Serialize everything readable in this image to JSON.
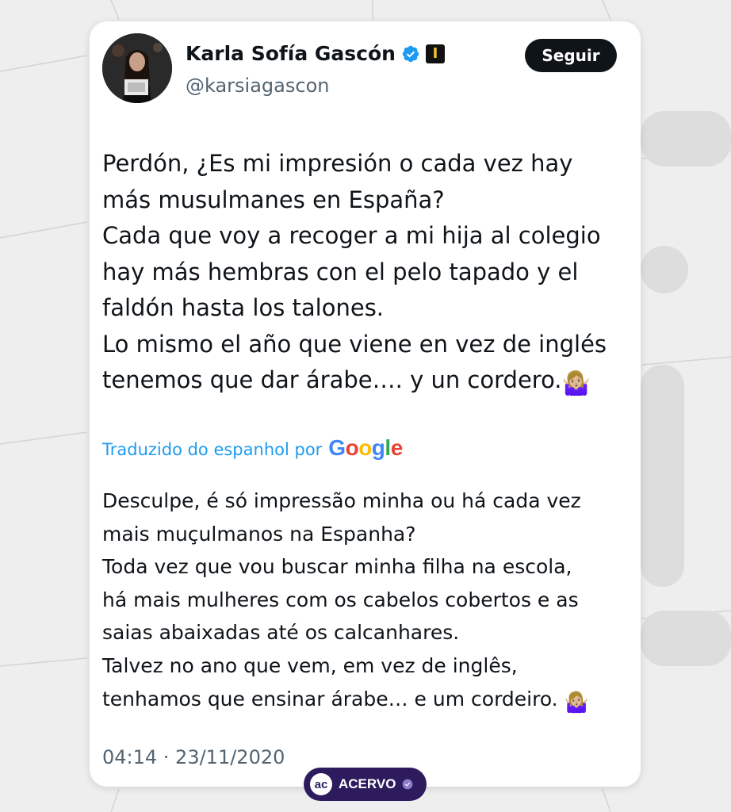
{
  "author": {
    "name": "Karla Sofía Gascón",
    "handle": "@karsiagascon",
    "avatar_icon": "profile-photo-woman-with-award",
    "verified_icon": "verified-check-icon",
    "badge_icon": "oscar-award-icon"
  },
  "follow_label": "Seguir",
  "tweet": {
    "lines": [
      "Perdón, ¿Es mi impresión o cada vez hay",
      "más musulmanes en España?",
      "Cada que voy a recoger a mi hija al colegio",
      "hay más hembras con el pelo tapado y el",
      "faldón hasta los talones.",
      "Lo mismo el año que viene en vez de inglés",
      "tenemos que dar árabe…. y un cordero."
    ],
    "emoji": "🤷🏼‍♀️"
  },
  "translation": {
    "label": "Traduzido do espanhol por",
    "provider": "Google",
    "lines": [
      "Desculpe, é só impressão minha ou há cada vez",
      "mais muçulmanos na Espanha?",
      "Toda vez que vou buscar minha filha na escola,",
      "há mais mulheres com os cabelos cobertos e as",
      "saias abaixadas até os calcanhares.",
      "Talvez no ano que vem, em vez de inglês,",
      "tenhamos que ensinar árabe… e um cordeiro."
    ],
    "emoji": "🤷🏼‍♀️"
  },
  "timestamp": "04:14 · 23/11/2020",
  "watermark": {
    "logo": "ac",
    "label": "ACERVO"
  },
  "colors": {
    "link_blue": "#1d9bf0",
    "verified_blue": "#1d9bf0",
    "google_blue": "#4285f4",
    "google_red": "#ea4335",
    "google_yellow": "#fbbc05",
    "google_green": "#34a853",
    "watermark_bg": "#2d1b5e"
  }
}
